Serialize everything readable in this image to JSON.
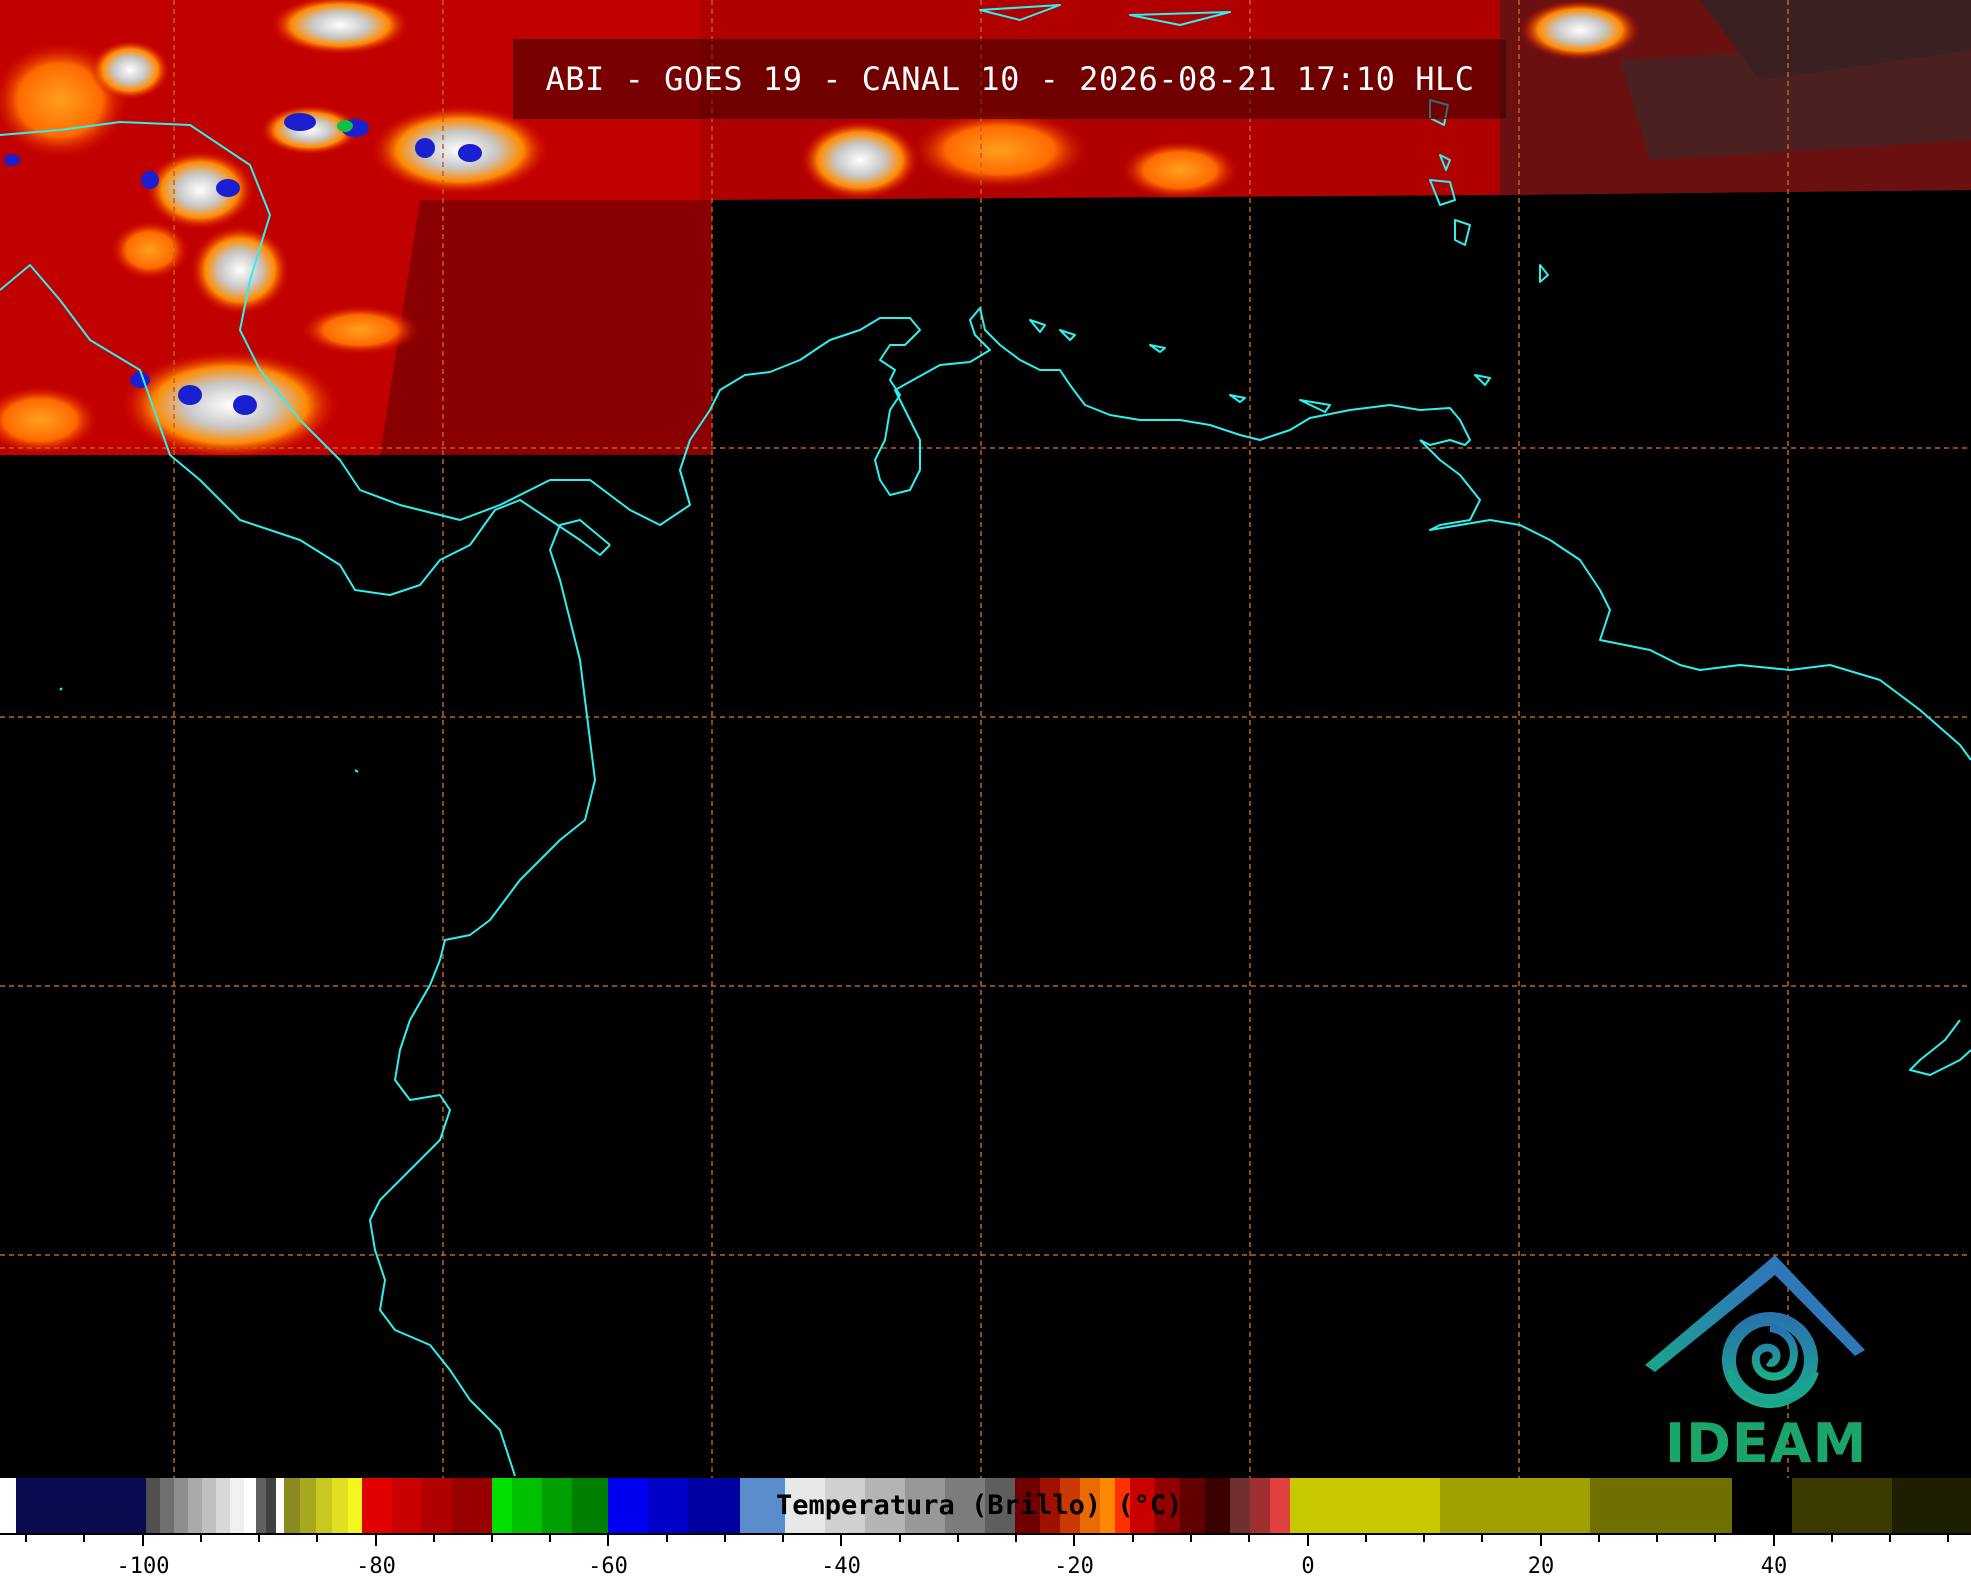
{
  "title": "ABI - GOES 19 - CANAL 10 - 2026-08-21 17:10 HLC",
  "colorbar": {
    "label": "Temperatura (Brillo) (°C)",
    "ticks": [
      "-100",
      "-80",
      "-60",
      "-40",
      "-20",
      "0",
      "20",
      "40"
    ],
    "range_celsius": [
      -112,
      56
    ]
  },
  "logo": {
    "text": "IDEAM"
  },
  "colors": {
    "coastline": "#2ff0f0",
    "grid": "#c0621e",
    "background": "#000000",
    "cloud_field": "#b00000",
    "logo_text": "#1aa56b"
  },
  "icons": [
    "ideam-logo-icon"
  ]
}
